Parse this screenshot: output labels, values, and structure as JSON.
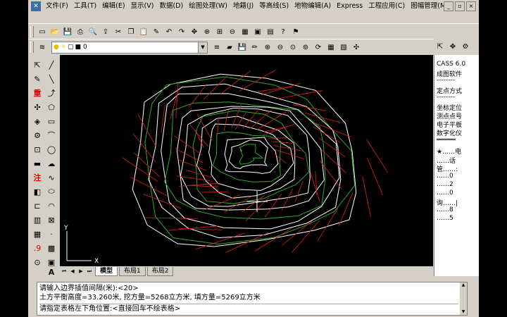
{
  "menubar": {
    "items": [
      "文件(F)",
      "工具(T)",
      "编辑(E)",
      "显示(V)",
      "数据(D)",
      "绘图处理(W)",
      "地籍(J)",
      "等高线(S)",
      "地物编辑(A)",
      "Express",
      "工程应用(C)",
      "图幅管理(M)"
    ]
  },
  "layer": {
    "current": "0"
  },
  "right_panel": {
    "items": [
      "CASS 6.0",
      "成图软件",
      "--------",
      "定点方式",
      "--------",
      "坐标定位",
      "测点点号",
      "电子平板",
      "数字化仪",
      "═════",
      "★……电",
      "……话",
      "管……:",
      "……0",
      "……2",
      "……0",
      "询……|",
      "……8",
      "……5"
    ]
  },
  "tabs": {
    "model": "模型",
    "layout1": "布局1",
    "layout2": "布局2"
  },
  "axis": {
    "x": "X",
    "y": "Y"
  },
  "command": {
    "line1": "请输入边界插值间隔(米):<20>",
    "line2": "土方平衡高度=33.260米,  挖方量=5268立方米,  填方量=5269立方米",
    "line3": "请指定表格左下角位置:<直接回车不绘表格>"
  },
  "colors": {
    "contour_white": "#ffffff",
    "contour_green": "#2ea82e",
    "tin_red": "#e02020",
    "canvas": "#000000"
  }
}
